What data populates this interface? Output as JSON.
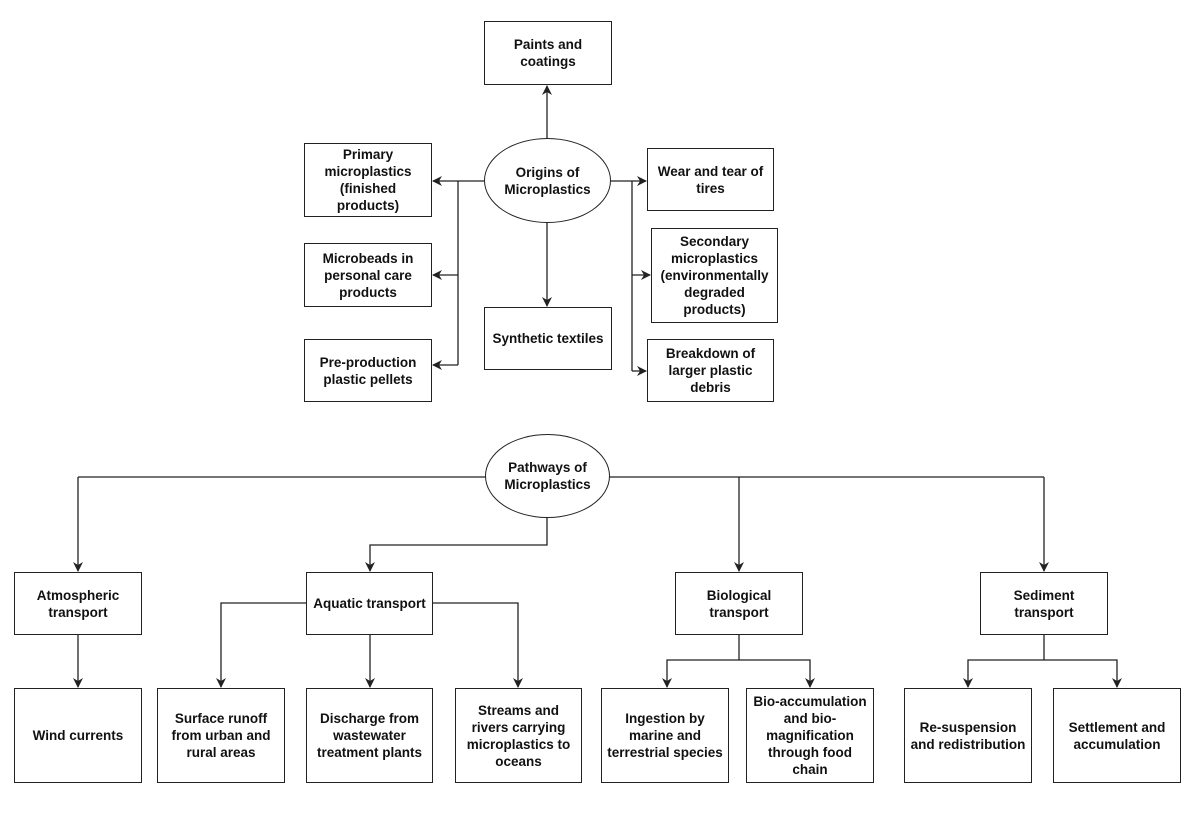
{
  "origins": {
    "center": "Origins of Microplastics",
    "paints": "Paints and coatings",
    "primary": "Primary microplastics (finished products)",
    "microbeads": "Microbeads in personal care products",
    "pellets": "Pre-production plastic pellets",
    "textiles": "Synthetic textiles",
    "tires": "Wear and tear of tires",
    "secondary": "Secondary microplastics (environmentally degraded products)",
    "breakdown": "Breakdown of larger plastic debris"
  },
  "pathways": {
    "center": "Pathways of Microplastics",
    "atmospheric": "Atmospheric transport",
    "aquatic": "Aquatic transport",
    "biological": "Biological transport",
    "sediment": "Sediment transport",
    "wind": "Wind currents",
    "runoff": "Surface runoff from urban and rural areas",
    "discharge": "Discharge from wastewater treatment plants",
    "streams": "Streams and rivers carrying microplastics to oceans",
    "ingestion": "Ingestion by marine and terrestrial species",
    "bioaccumulation": "Bio-accumulation and bio-magnification through food chain",
    "resuspension": "Re-suspension and redistribution",
    "settlement": "Settlement and accumulation"
  },
  "colors": {
    "line": "#222222",
    "fill": "#ffffff"
  }
}
